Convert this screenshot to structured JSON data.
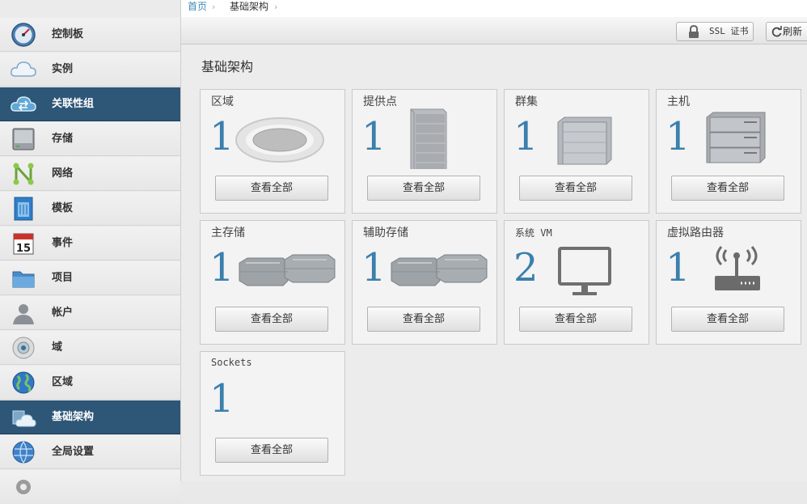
{
  "breadcrumb": {
    "home": "首页",
    "current": "基础架构",
    "separator": "›"
  },
  "sidebar": {
    "items": [
      {
        "label": "控制板",
        "icon": "dashboard-gauge-icon",
        "active": false
      },
      {
        "label": "实例",
        "icon": "cloud-icon",
        "active": false
      },
      {
        "label": "关联性组",
        "icon": "cloud-exchange-icon",
        "active": true
      },
      {
        "label": "存储",
        "icon": "storage-drive-icon",
        "active": false
      },
      {
        "label": "网络",
        "icon": "network-n-icon",
        "active": false
      },
      {
        "label": "模板",
        "icon": "template-trash-icon",
        "active": false
      },
      {
        "label": "事件",
        "icon": "calendar-icon",
        "active": false
      },
      {
        "label": "项目",
        "icon": "folder-icon",
        "active": false
      },
      {
        "label": "帐户",
        "icon": "user-icon",
        "active": false
      },
      {
        "label": "域",
        "icon": "domain-disc-icon",
        "active": false
      },
      {
        "label": "区域",
        "icon": "globe-icon",
        "active": false
      },
      {
        "label": "基础架构",
        "icon": "infrastructure-cloud-icon",
        "active": true
      },
      {
        "label": "全局设置",
        "icon": "globe-settings-icon",
        "active": false
      },
      {
        "label": "",
        "icon": "gear-icon",
        "active": false
      }
    ]
  },
  "toolbar": {
    "ssl_label": "SSL 证书",
    "refresh_label": "刷新"
  },
  "page_title": "基础架构",
  "cards": [
    {
      "title": "区域",
      "count": "1",
      "button": "查看全部",
      "icon": "zone-disc-icon"
    },
    {
      "title": "提供点",
      "count": "1",
      "button": "查看全部",
      "icon": "pod-rack-icon"
    },
    {
      "title": "群集",
      "count": "1",
      "button": "查看全部",
      "icon": "cluster-box-icon"
    },
    {
      "title": "主机",
      "count": "1",
      "button": "查看全部",
      "icon": "host-server-icon"
    },
    {
      "title": "主存储",
      "count": "1",
      "button": "查看全部",
      "icon": "primary-storage-icon"
    },
    {
      "title": "辅助存储",
      "count": "1",
      "button": "查看全部",
      "icon": "secondary-storage-icon"
    },
    {
      "title": "系统 VM",
      "count": "2",
      "button": "查看全部",
      "icon": "monitor-icon"
    },
    {
      "title": "虚拟路由器",
      "count": "1",
      "button": "查看全部",
      "icon": "router-icon"
    },
    {
      "title": "Sockets",
      "count": "1",
      "button": "查看全部",
      "icon": ""
    }
  ],
  "colors": {
    "accent": "#3b7fad",
    "active_nav": "#2d5677",
    "link": "#3e8ab8"
  }
}
